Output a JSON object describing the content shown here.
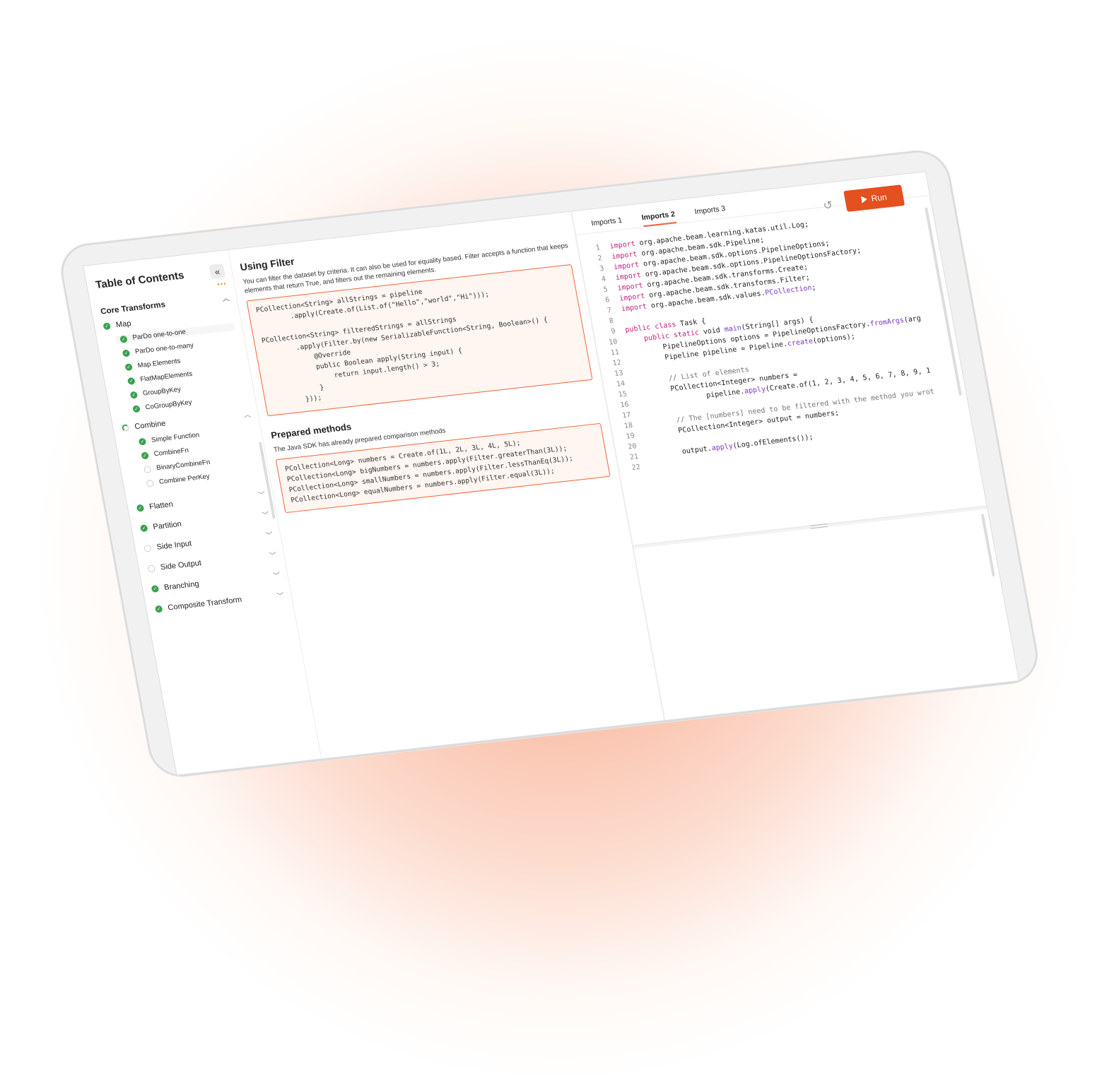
{
  "toc": {
    "title": "Table of Contents",
    "collapse_icon": "«",
    "dots": "•••",
    "section": "Core Transforms",
    "map": {
      "label": "Map",
      "items": [
        "ParDo one-to-one",
        "ParDo one-to-many",
        "Map Elements",
        "FlatMapElements",
        "GroupByKey",
        "CoGroupByKey"
      ]
    },
    "combine": {
      "label": "Combine",
      "done_items": [
        "Simple Function",
        "CombineFn"
      ],
      "todo_items": [
        "BinaryCombineFn",
        "Combine PerKey"
      ]
    },
    "modules": {
      "flatten": "Flatten",
      "partition": "Partition",
      "side_input": "Side Input",
      "side_output": "Side Output",
      "branching": "Branching",
      "composite": "Composite Transform"
    }
  },
  "content": {
    "heading": "Using Filter",
    "paragraph": "You can filter the dataset by criteria. It can also be used for equality based. Filter accepts a function that keeps elements that return True, and filters out the remaining elements.",
    "code1": "PCollection<String> allStrings = pipeline\n        .apply(Create.of(List.of(\"Hello\",\"world\",\"Hi\")));\n\nPCollection<String> filteredStrings = allStrings\n        .apply(Filter.by(new SerializableFunction<String, Boolean>() {\n            @Override\n            public Boolean apply(String input) {\n                return input.length() > 3;\n            }\n        }));",
    "heading2": "Prepared methods",
    "paragraph2": "The Java SDK has already prepared comparison methods",
    "code2": "PCollection<Long> numbers = Create.of(1L, 2L, 3L, 4L, 5L);\nPCollection<Long> bigNumbers = numbers.apply(Filter.greaterThan(3L));\nPCollection<Long> smallNumbers = numbers.apply(Filter.lessThanEq(3L));\nPCollection<Long> equalNumbers = numbers.apply(Filter.equal(3L));"
  },
  "editor": {
    "tabs": [
      "Imports 1",
      "Imports 2",
      "Imports 3"
    ],
    "active_tab": "Imports 2",
    "run_label": "Run",
    "reset_icon": "↺",
    "code_lines": [
      {
        "n": "1",
        "kw": "import",
        "rest": " org.apache.beam.learning.katas.util.Log;"
      },
      {
        "n": "2",
        "kw": "import",
        "rest": " org.apache.beam.sdk.Pipeline;"
      },
      {
        "n": "3",
        "kw": "import",
        "rest": " org.apache.beam.sdk.options.PipelineOptions;"
      },
      {
        "n": "4",
        "kw": "import",
        "rest": " org.apache.beam.sdk.options.PipelineOptionsFactory;"
      },
      {
        "n": "5",
        "kw": "import",
        "rest": " org.apache.beam.sdk.transforms.Create;"
      },
      {
        "n": "6",
        "kw": "import",
        "rest": " org.apache.beam.sdk.transforms.Filter;"
      },
      {
        "n": "7",
        "kw": "import",
        "rest": " org.apache.beam.sdk.values.",
        "fn": "PCollection",
        "tail": ";"
      },
      {
        "n": "8",
        "rest": ""
      },
      {
        "n": "9",
        "kw": "public class",
        "rest": " Task {"
      },
      {
        "n": "10",
        "pre": "    ",
        "kw": "public static",
        "rest": " void ",
        "fn": "main",
        "tail": "(String[] args) {"
      },
      {
        "n": "11",
        "rest": "        PipelineOptions options = PipelineOptionsFactory.",
        "fn": "fromArgs",
        "tail": "(arg"
      },
      {
        "n": "12",
        "rest": "        Pipeline pipeline = Pipeline.",
        "fn": "create",
        "tail": "(options);"
      },
      {
        "n": "13",
        "rest": ""
      },
      {
        "n": "14",
        "cm": "        // List of elements"
      },
      {
        "n": "15",
        "rest": "        PCollection<Integer> numbers ="
      },
      {
        "n": "16",
        "rest": "                pipeline.",
        "fn": "apply",
        "tail": "(Create.of(1, 2, 3, 4, 5, 6, 7, 8, 9, 1"
      },
      {
        "n": "17",
        "rest": ""
      },
      {
        "n": "18",
        "cm": "        // The [numbers] need to be filtered with the method you wrot"
      },
      {
        "n": "19",
        "rest": "        PCollection<Integer> output = numbers;"
      },
      {
        "n": "20",
        "rest": ""
      },
      {
        "n": "21",
        "rest": "        output.",
        "fn": "apply",
        "tail": "(Log.ofElements());"
      },
      {
        "n": "22",
        "rest": ""
      }
    ]
  }
}
